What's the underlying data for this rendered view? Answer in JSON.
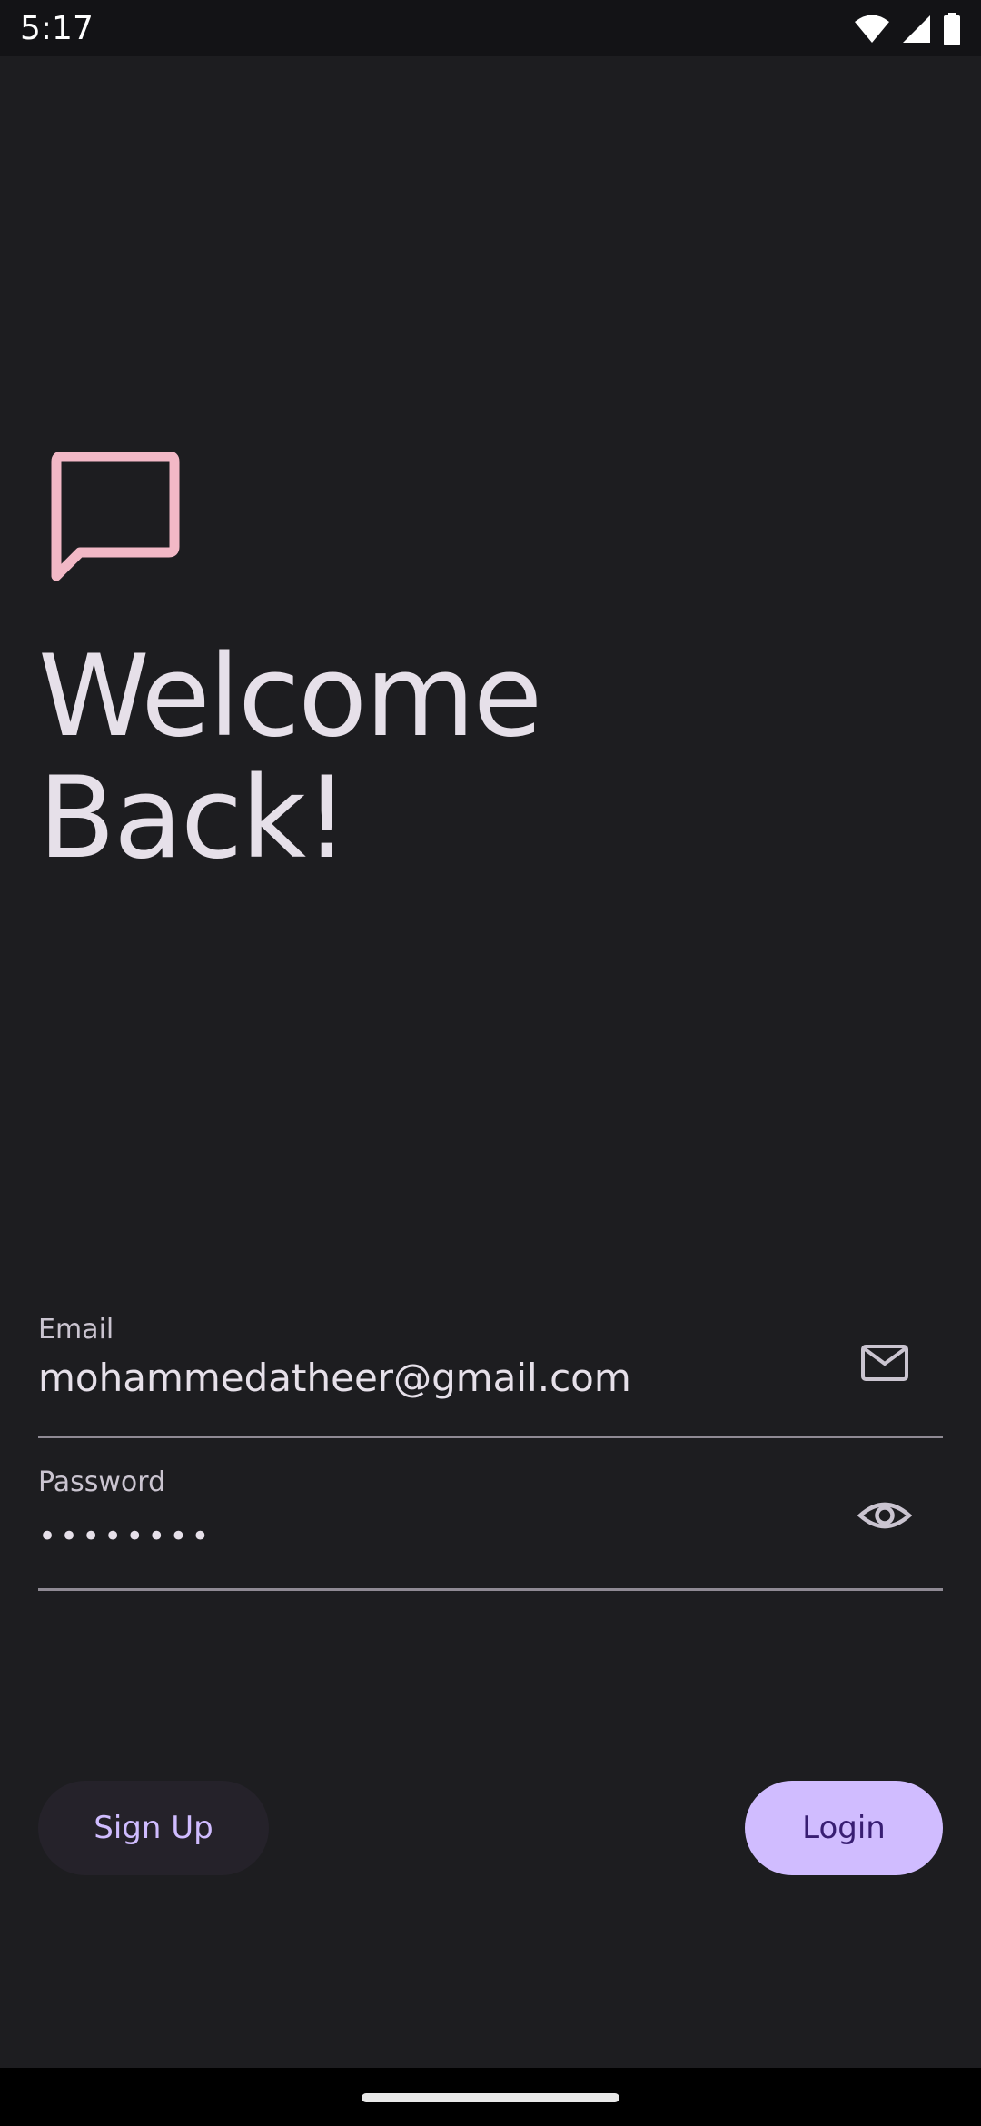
{
  "status_bar": {
    "time": "5:17",
    "icons": [
      "wifi-icon",
      "signal-icon",
      "battery-icon"
    ]
  },
  "header": {
    "logo_icon": "chat-bubble-icon",
    "logo_color": "#f2b8c6",
    "title": "Welcome Back!"
  },
  "form": {
    "email": {
      "label": "Email",
      "value": "mohammedatheer@gmail.com",
      "icon": "mail-icon"
    },
    "password": {
      "label": "Password",
      "value": "••••••••",
      "icon": "eye-icon"
    }
  },
  "actions": {
    "signup_label": "Sign Up",
    "login_label": "Login"
  },
  "colors": {
    "background": "#1d1d20",
    "primary": "#d0bcff",
    "on_primary": "#381e72",
    "accent_pink": "#f2b8c6"
  }
}
